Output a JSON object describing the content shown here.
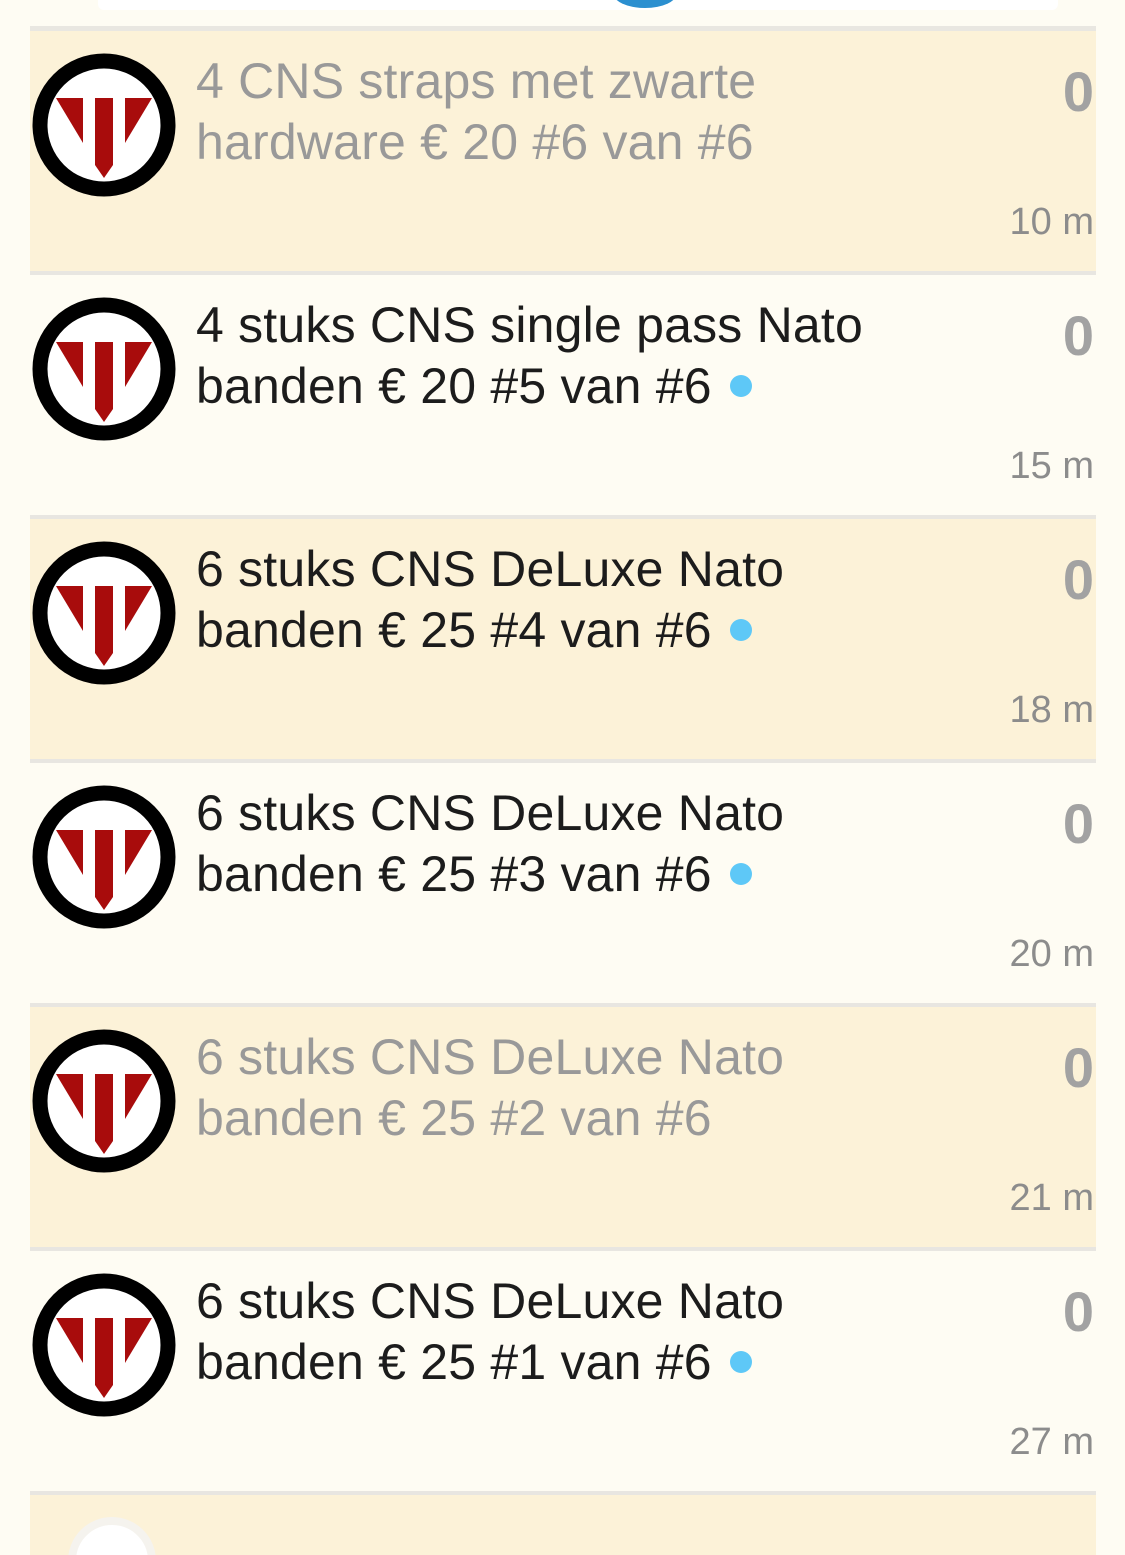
{
  "colors": {
    "page_background": "#fefcf3",
    "highlight_background": "#fcf2d8",
    "unread_dot": "#5ec8f7",
    "logo_ring": "#000000",
    "logo_mark": "#a80c0c"
  },
  "items": [
    {
      "title": "4 CNS straps met zwarte hardware € 20 #6 van #6",
      "count": "0",
      "time": "10 m",
      "unread": false,
      "icon": "brand-logo-icon"
    },
    {
      "title": "4 stuks CNS single pass Nato banden € 20 #5 van #6",
      "count": "0",
      "time": "15 m",
      "unread": true,
      "icon": "brand-logo-icon"
    },
    {
      "title": "6 stuks CNS DeLuxe Nato banden € 25 #4 van #6",
      "count": "0",
      "time": "18 m",
      "unread": true,
      "icon": "brand-logo-icon"
    },
    {
      "title": "6 stuks CNS DeLuxe Nato banden € 25 #3 van #6",
      "count": "0",
      "time": "20 m",
      "unread": true,
      "icon": "brand-logo-icon"
    },
    {
      "title": "6 stuks CNS DeLuxe Nato banden € 25 #2 van #6",
      "count": "0",
      "time": "21 m",
      "unread": false,
      "icon": "brand-logo-icon"
    },
    {
      "title": "6 stuks CNS DeLuxe Nato banden € 25 #1 van #6",
      "count": "0",
      "time": "27 m",
      "unread": true,
      "icon": "brand-logo-icon"
    }
  ]
}
